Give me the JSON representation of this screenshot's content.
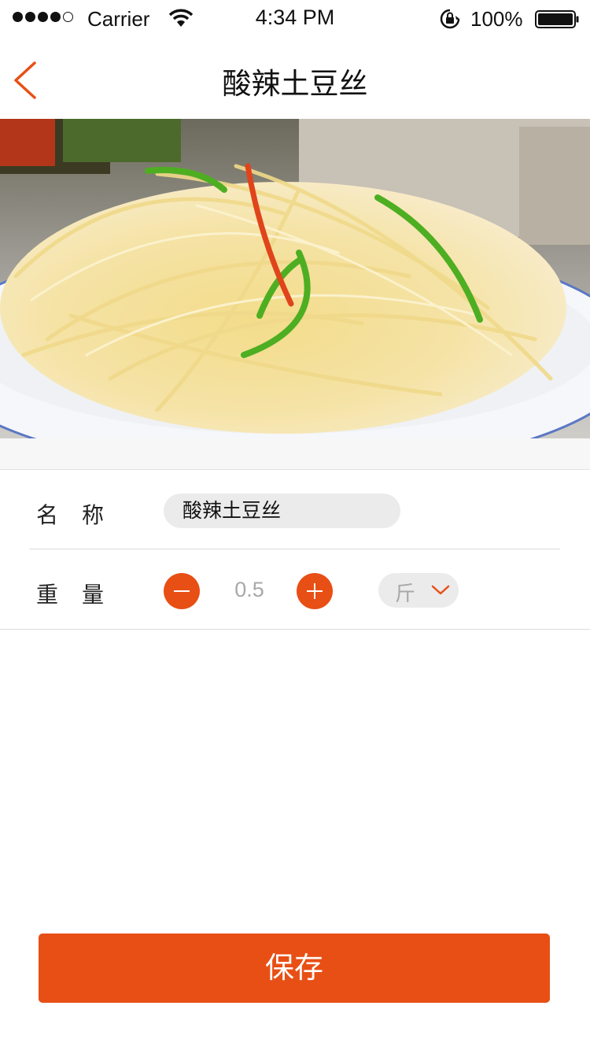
{
  "status_bar": {
    "carrier": "Carrier",
    "time": "4:34 PM",
    "battery_percent": "100%",
    "signal_bars_filled": 4,
    "signal_bars_total": 5,
    "battery_level": 1.0
  },
  "nav": {
    "title": "酸辣土豆丝",
    "back_icon": "chevron-left-icon",
    "accent_color": "#e84f15"
  },
  "hero": {
    "icon": "food-photo"
  },
  "form": {
    "name": {
      "label": "名称",
      "value": "酸辣土豆丝"
    },
    "weight": {
      "label": "重量",
      "quantity": "0.5",
      "minus_icon": "minus-circle-icon",
      "plus_icon": "plus-circle-icon",
      "unit": "斤",
      "unit_icon": "chevron-down-icon"
    }
  },
  "save_button": {
    "label": "保存",
    "color": "#e84f15"
  }
}
